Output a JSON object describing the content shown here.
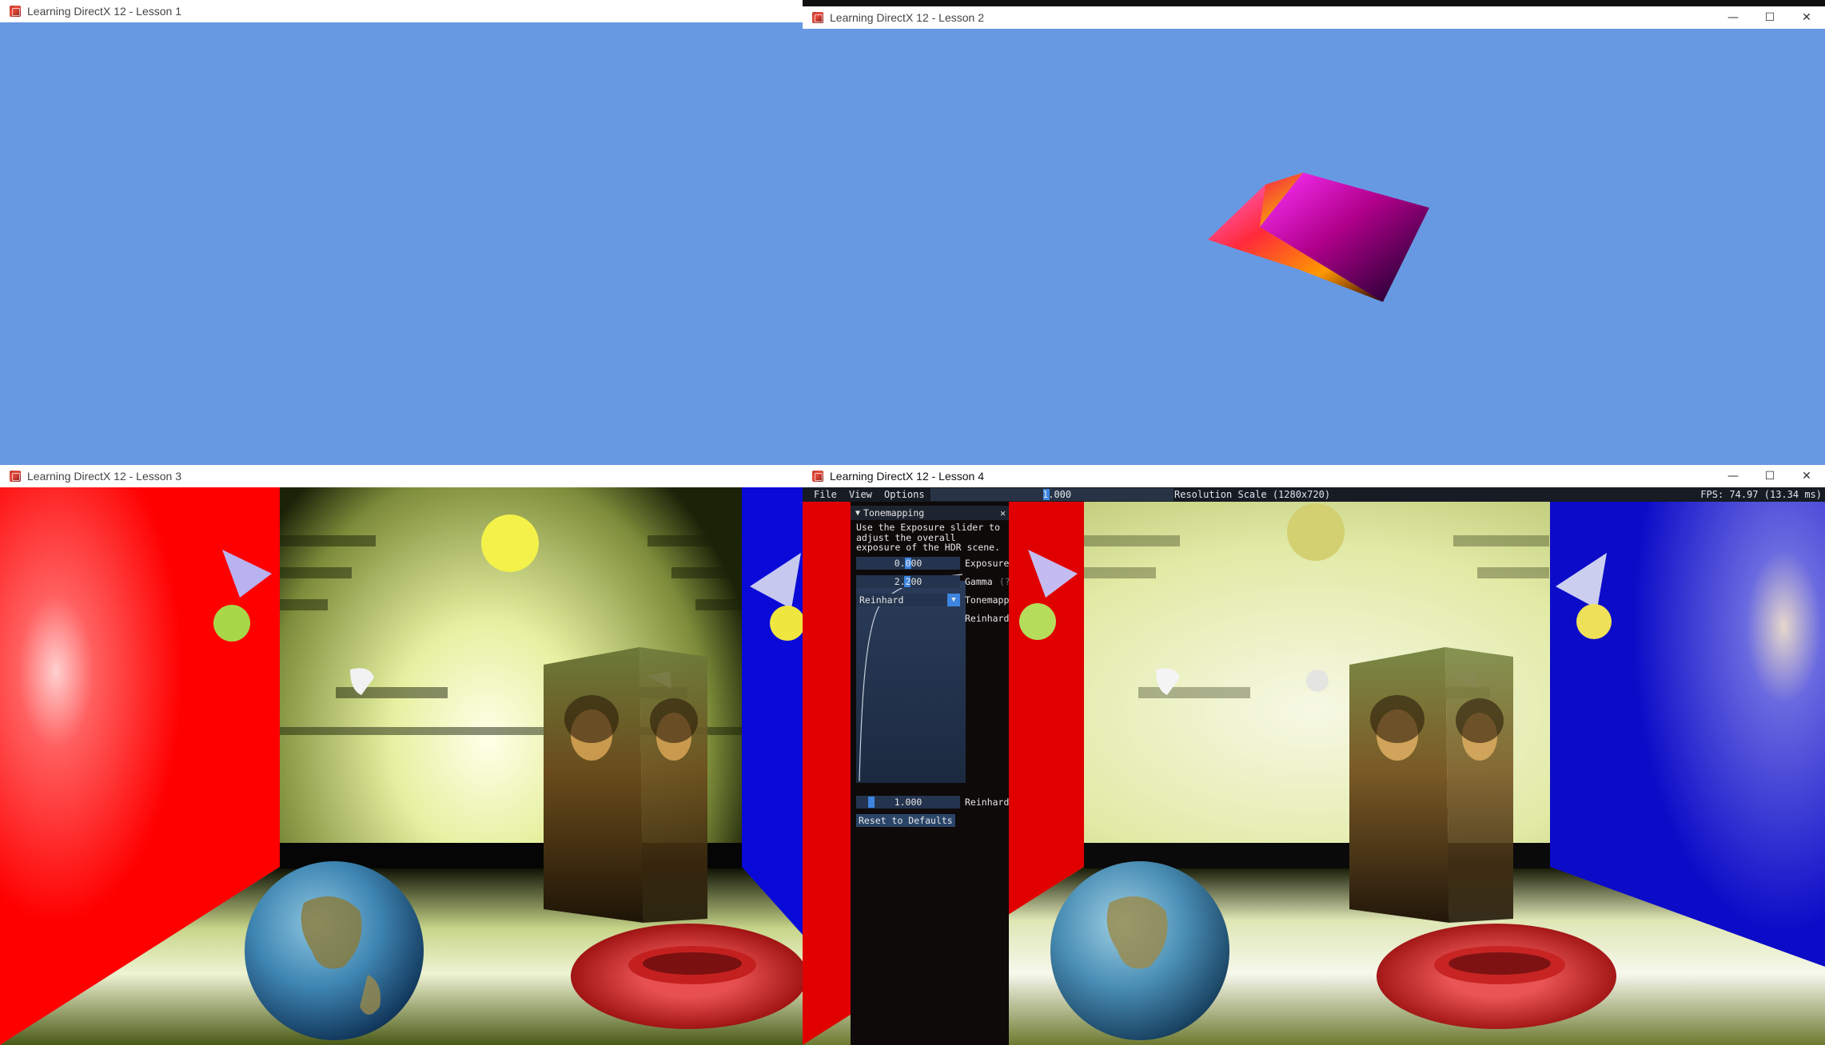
{
  "colors": {
    "clear_blue": "#6799e3",
    "imgui_bg": "#0e0a0a",
    "imgui_field": "#24344e",
    "imgui_accent": "#3d85e0"
  },
  "windows": {
    "lesson1": {
      "title": "Learning DirectX 12 - Lesson 1"
    },
    "lesson2": {
      "title": "Learning DirectX 12 - Lesson 2",
      "minimize_glyph": "—",
      "maximize_glyph": "☐",
      "close_glyph": "✕"
    },
    "lesson3": {
      "title": "Learning DirectX 12 - Lesson 3"
    },
    "lesson4": {
      "title": "Learning DirectX 12 - Lesson 4",
      "minimize_glyph": "—",
      "maximize_glyph": "☐",
      "close_glyph": "✕",
      "menubar": {
        "file": "File",
        "view": "View",
        "options": "Options",
        "resolution_scale_value": "1.000",
        "resolution_label": "Resolution Scale (1280x720)",
        "fps": "FPS: 74.97 (13.34 ms)"
      },
      "tonemapping": {
        "title": "Tonemapping",
        "collapse_glyph": "▼",
        "close_glyph": "✕",
        "description_lines": [
          "Use the Exposure slider to",
          "adjust the overall",
          "exposure of the HDR scene."
        ],
        "exposure_value": "0.000",
        "exposure_label": "Exposure",
        "gamma_value": "2.200",
        "gamma_label": "Gamma",
        "gamma_help": "(?",
        "tonemap_method": "Reinhard",
        "tonemap_label": "Tonemapp",
        "dropdown_glyph": "▼",
        "curve_label": "Reinhard",
        "max_luminance_value": "1.000",
        "max_luminance_label": "Reinhard",
        "reset_button": "Reset to Defaults"
      }
    }
  }
}
